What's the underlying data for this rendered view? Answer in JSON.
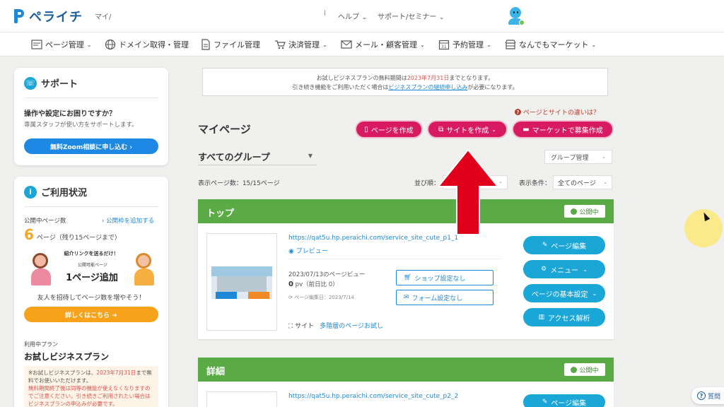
{
  "header": {
    "logo_text": "ペライチ",
    "mypage_short": "マイ/",
    "separator": "l",
    "help": "ヘルプ",
    "support": "サポート/セミナー"
  },
  "nav": {
    "items": [
      {
        "label": "ページ管理",
        "icon": "page-icon"
      },
      {
        "label": "ドメイン取得・管理",
        "icon": "globe-icon"
      },
      {
        "label": "ファイル管理",
        "icon": "file-icon"
      },
      {
        "label": "決済管理",
        "icon": "cart-icon"
      },
      {
        "label": "メール・顧客管理",
        "icon": "mail-icon"
      },
      {
        "label": "予約管理",
        "icon": "calendar-icon"
      },
      {
        "label": "なんでもマーケット",
        "icon": "store-icon"
      }
    ]
  },
  "support": {
    "title": "サポート",
    "question": "操作や設定にお困りですか？",
    "sub": "専属スタッフが使い方をサポートします。",
    "button": "無料Zoom相談に申し込む ›"
  },
  "usage": {
    "title": "ご利用状況",
    "published_label": "公開中ページ数",
    "add_link": "› 公開枠を追加する",
    "count": "6",
    "count_unit": "ページ（残り15ページまで）",
    "promo_bubble": "紹介リンクを送るだけ！",
    "promo_sub": "公開可能ページ",
    "promo_big": "1ページ追加",
    "invite_text": "友人を招待してページ数を増やそう！",
    "details_button": "詳しくはこちら ➜",
    "plan_label": "利用中プラン",
    "plan_name": "お試しビジネスプラン",
    "plan_note_1": "※お試しビジネスプランは、",
    "plan_note_date": "2023年7月31日",
    "plan_note_2": "まで無料でお使いいただけます。",
    "plan_note_3": "無料期間終了後は同等の機能が使えなくなりますのでご注意ください。引き続きご利用されたい場合はビジネスプランの申込みが必要です。"
  },
  "notice": {
    "line1_a": "お試しビジネスプランの無料期間は",
    "line1_date": "2023年7月31日",
    "line1_b": "までとなります。",
    "line2_a": "引き続き機能をご利用いただく場合は",
    "line2_link": "ビジネスプランの継続申し込み",
    "line2_b": "が必要になります。"
  },
  "main": {
    "diff_link": "ページとサイトの違いは？",
    "title": "マイページ",
    "btn_create_page": "ページを作成",
    "btn_create_site": "サイトを作成",
    "btn_market": "マーケットで募集作成",
    "group": "すべてのグループ",
    "group_mgmt": "グループ管理",
    "count_text": "表示ページ数：15/15ページ",
    "sort_label": "並び順：",
    "filter_label": "表示条件：",
    "filter_value": "全てのページ"
  },
  "cards": [
    {
      "title": "トップ",
      "status": "公開中",
      "url": "https://qat5u.hp.peraichi.com/service_site_cute_p1_1",
      "preview": "プレビュー",
      "views_label": "2023/07/13のページビュー",
      "pv": "0",
      "pv_unit": "pv（前日比 0）",
      "edited": "ページ編集日：2023/7/14",
      "shop_btn": "ショップ設定なし",
      "form_btn": "フォーム設定なし",
      "site_label": "サイト",
      "site_link": "多階層のページお試し",
      "edit_btn": "ページ編集",
      "menu_btn": "メニュー",
      "settings_btn": "ページの基本設定",
      "analytics_btn": "アクセス解析"
    },
    {
      "title": "詳細",
      "status": "公開中",
      "url": "https://qat5u.hp.peraichi.com/service_site_cute_p2_2",
      "edit_btn": "ページ編集"
    }
  ],
  "help_chip": "質問",
  "colors": {
    "brand": "#1e88d6",
    "pink": "#d81b60",
    "green": "#5aab45",
    "orange": "#f7a21b",
    "arrow": "#e0001a"
  }
}
